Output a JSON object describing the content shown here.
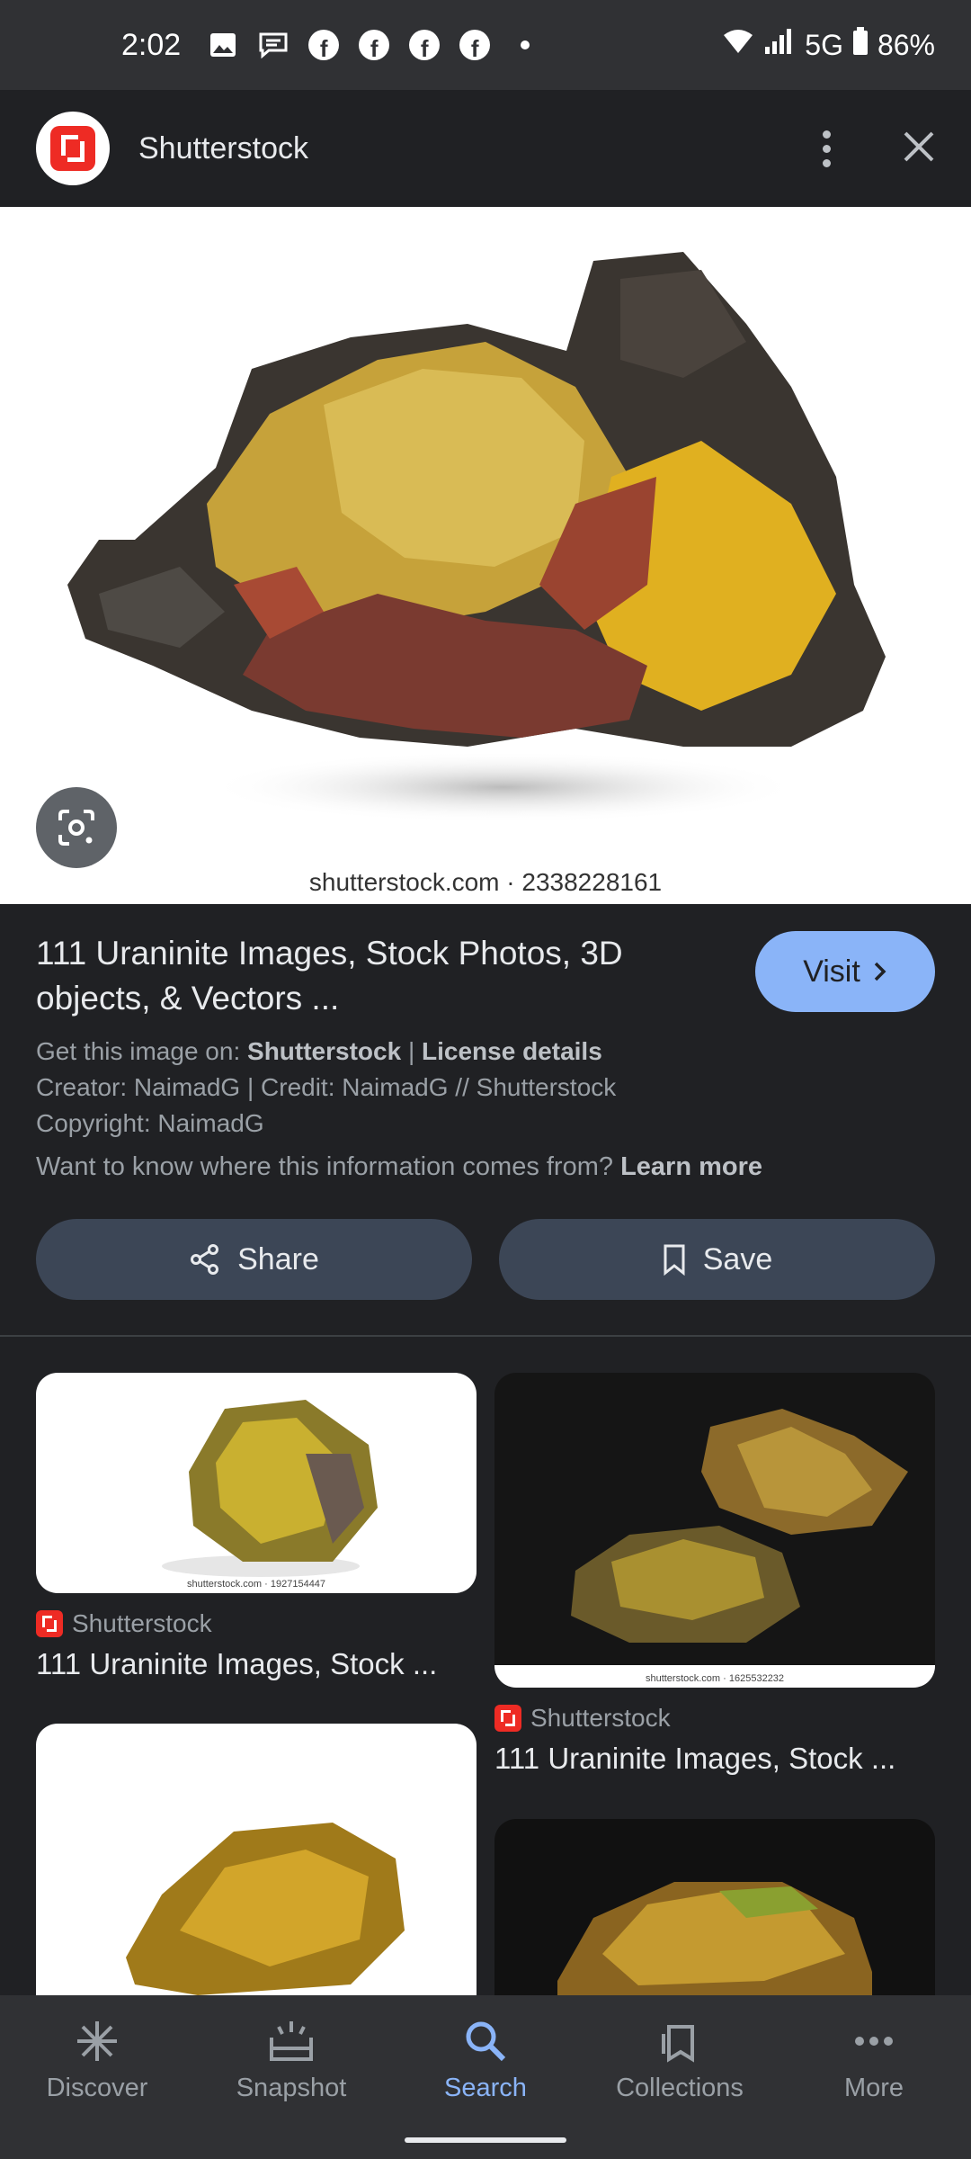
{
  "status_bar": {
    "time": "2:02",
    "network": "5G",
    "battery": "86%"
  },
  "header": {
    "site_name": "Shutterstock"
  },
  "hero": {
    "watermark": "shutterstock.com · 2338228161"
  },
  "result": {
    "title": "111 Uraninite Images, Stock Photos, 3D objects, & Vectors ...",
    "visit_label": "Visit",
    "get_image_prefix": "Get this image on:",
    "get_image_source": "Shutterstock",
    "separator": "|",
    "license_label": "License details",
    "creator_line": "Creator: NaimadG | Credit: NaimadG // Shutterstock",
    "copyright_line": "Copyright: NaimadG",
    "info_question": "Want to know where this information comes from?",
    "learn_more": "Learn more"
  },
  "actions": {
    "share_label": "Share",
    "save_label": "Save"
  },
  "related": [
    {
      "source": "Shutterstock",
      "title": "111 Uraninite Images, Stock ...",
      "watermark": "shutterstock.com · 1927154447"
    },
    {
      "source": "Shutterstock",
      "title": "111 Uraninite Images, Stock ...",
      "watermark": "shutterstock.com · 1625532232"
    }
  ],
  "bottom_nav": {
    "items": [
      {
        "label": "Discover",
        "icon": "asterisk-icon"
      },
      {
        "label": "Snapshot",
        "icon": "snapshot-icon"
      },
      {
        "label": "Search",
        "icon": "search-icon",
        "active": true
      },
      {
        "label": "Collections",
        "icon": "collections-icon"
      },
      {
        "label": "More",
        "icon": "more-icon"
      }
    ]
  },
  "colors": {
    "background": "#202124",
    "accent": "#8ab4f8",
    "action_button": "#3c4656",
    "brand": "#ee2b24"
  }
}
